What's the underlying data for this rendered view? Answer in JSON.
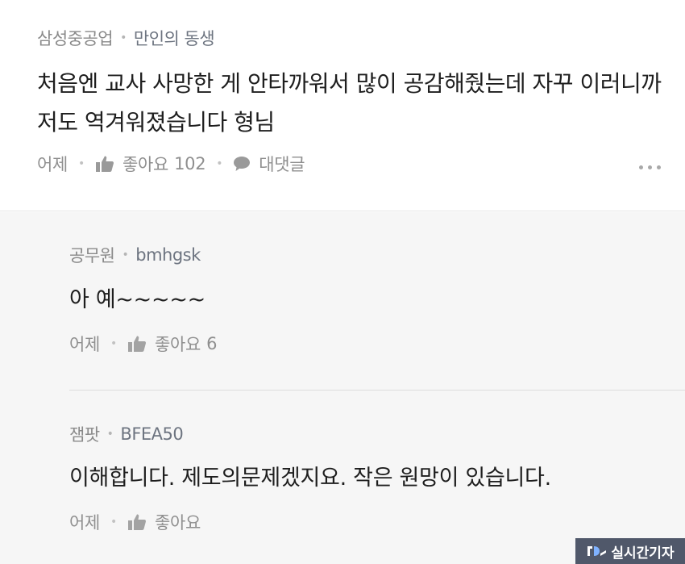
{
  "main_comment": {
    "author": "삼성중공업",
    "nickname": "만인의 동생",
    "text": "처음엔 교사 사망한 게 안타까워서 많이 공감해줬는데 자꾸 이러니까 저도 역겨워졌습니다 형님",
    "time": "어제",
    "like_label": "좋아요",
    "like_count": "102",
    "reply_label": "대댓글"
  },
  "replies": [
    {
      "author": "공무원",
      "nickname": "bmhgsk",
      "text": "아 예~~~~~",
      "time": "어제",
      "like_label": "좋아요",
      "like_count": "6"
    },
    {
      "author": "잼팟",
      "nickname": "BFEA50",
      "text": "이해합니다. 제도의문제겠지요. 작은 원망이 있습니다.",
      "time": "어제",
      "like_label": "좋아요",
      "like_count": ""
    }
  ],
  "watermark": {
    "text": "실시간기자"
  },
  "icons": {
    "like": "thumbs-up-icon",
    "reply": "speech-bubble-icon",
    "more": "more-dots-icon"
  },
  "colors": {
    "reply_background": "#f6f6f6",
    "meta_text": "#8a8a8a",
    "watermark_bg": "#50586a"
  }
}
